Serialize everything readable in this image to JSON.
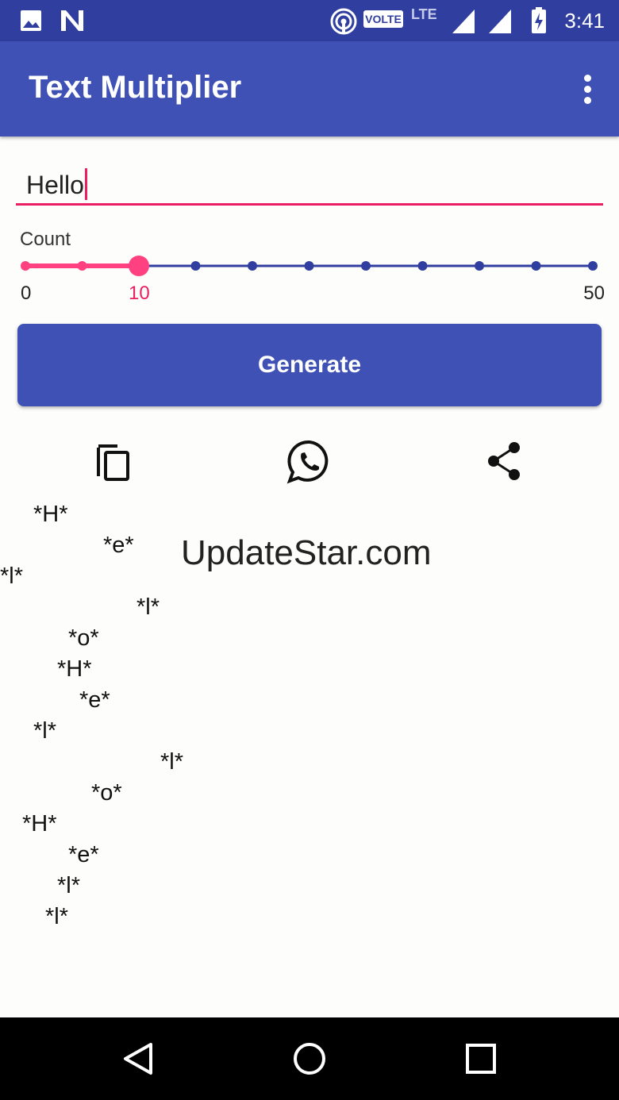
{
  "status_bar": {
    "time": "3:41",
    "volte_badge": "VOLTE",
    "lte_label": "LTE",
    "icons": [
      "image-icon",
      "n-icon",
      "hotspot-icon",
      "signal-icon",
      "signal-icon",
      "battery-charging-icon"
    ],
    "color": "#303f9f"
  },
  "app_bar": {
    "title": "Text Multiplier",
    "menu_icon": "more-vert-icon",
    "color": "#3f51b5"
  },
  "input": {
    "value": "Hello",
    "accent": "#e91e63"
  },
  "count": {
    "label": "Count",
    "min_label": "0",
    "max_label": "50",
    "current_label": "10",
    "value": 10,
    "min": 0,
    "max": 50,
    "step": 5
  },
  "generate_button": {
    "label": "Generate"
  },
  "actions": [
    "copy-icon",
    "whatsapp-icon",
    "share-icon"
  ],
  "output_lines": [
    "*H*",
    "*e*",
    "*l*",
    "*l*",
    "*o*",
    "*H*",
    "*e*",
    "*l*",
    "*l*",
    "*o*",
    "*H*",
    "*e*",
    "*l*",
    "*l*"
  ],
  "watermark": "UpdateStar.com",
  "nav_bar": [
    "back-icon",
    "home-icon",
    "recents-icon"
  ]
}
